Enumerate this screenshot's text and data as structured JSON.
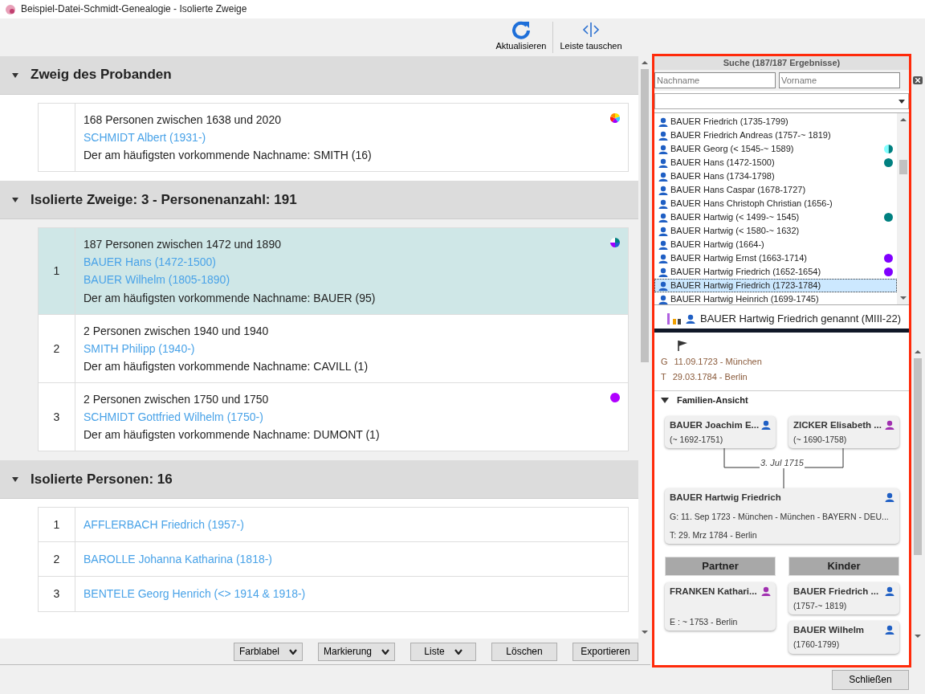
{
  "window": {
    "title": "Beispiel-Datei-Schmidt-Genealogie - Isolierte Zweige"
  },
  "toolbar": [
    {
      "label": "Aktualisieren",
      "kind": "refresh"
    },
    {
      "label": "Leiste tauschen",
      "kind": "swap"
    }
  ],
  "sections": [
    {
      "title": "Zweig des Probanden",
      "expanded": true,
      "items": [
        {
          "summary": "168 Personen zwischen 1638 und 2020",
          "persons": [
            "SCHMIDT Albert (1931-)"
          ],
          "note": "Der am häufigsten vorkommende Nachname: SMITH (16)",
          "selected": false,
          "segments": [
            {
              "color": "#ffe600"
            },
            {
              "color": "#33ccff"
            },
            {
              "color": "#a000ff"
            },
            {
              "color": "#ff1a1a"
            },
            {
              "color": "#ff8c00"
            }
          ]
        }
      ]
    },
    {
      "title": "Isolierte Zweige: 3 - Personenanzahl: 191",
      "expanded": true,
      "items": [
        {
          "number": "1",
          "summary": "187 Personen zwischen 1472 und 1890",
          "persons": [
            "BAUER Hans (1472-1500)",
            "BAUER Wilhelm (1805-1890)"
          ],
          "note": "Der am häufigsten vorkommende Nachname: BAUER (95)",
          "selected": true,
          "segments": [
            {
              "color": "#008080"
            },
            {
              "color": "#2060d0"
            },
            {
              "color": "#a000ff"
            },
            {
              "color": "#ffffff"
            }
          ]
        },
        {
          "number": "2",
          "summary": "2 Personen zwischen 1940 und 1940",
          "persons": [
            "SMITH Philipp (1940-)"
          ],
          "note": "Der am häufigsten vorkommende Nachname: CAVILL (1)",
          "selected": false
        },
        {
          "number": "3",
          "summary": "2 Personen zwischen 1750 und 1750",
          "persons": [
            "SCHMIDT Gottfried Wilhelm (1750-)"
          ],
          "note": "Der am häufigsten vorkommende Nachname: DUMONT (1)",
          "selected": false,
          "segments": [
            {
              "color": "#b000ff"
            }
          ]
        }
      ]
    },
    {
      "title": "Isolierte Personen: 16",
      "expanded": true,
      "items": [
        {
          "number": "1",
          "persons": [
            "AFFLERBACH Friedrich (1957-)"
          ],
          "selected": false
        },
        {
          "number": "2",
          "persons": [
            "BAROLLE Johanna Katharina (1818-)"
          ],
          "selected": false
        },
        {
          "number": "3",
          "persons": [
            "BENTELE Georg Henrich (<> 1914 & 1918-)"
          ],
          "selected": false
        }
      ]
    }
  ],
  "actions": [
    {
      "label": "Farblabel",
      "dropdown": true
    },
    {
      "label": "Markierung",
      "dropdown": true
    },
    {
      "label": "Liste",
      "dropdown": true
    },
    {
      "label": "Löschen",
      "dropdown": false
    },
    {
      "label": "Exportieren",
      "dropdown": false
    }
  ],
  "close_button": "Schließen",
  "side_panel": {
    "highlighted": true,
    "search": {
      "title": "Suche (187/187 Ergebnisse)",
      "surname_placeholder": "Nachname",
      "firstname_placeholder": "Vorname"
    },
    "results": [
      {
        "name": "BAUER Friedrich (1735-1799)",
        "selected": false
      },
      {
        "name": "BAUER Friedrich Andreas (1757-~ 1819)",
        "selected": false
      },
      {
        "name": "BAUER Georg (< 1545-~ 1589)",
        "selected": false,
        "segments": [
          {
            "color": "#008080"
          },
          {
            "color": "#80ffff"
          }
        ]
      },
      {
        "name": "BAUER Hans (1472-1500)",
        "selected": false,
        "segments": [
          {
            "color": "#008080"
          }
        ]
      },
      {
        "name": "BAUER Hans (1734-1798)",
        "selected": false
      },
      {
        "name": "BAUER Hans Caspar (1678-1727)",
        "selected": false
      },
      {
        "name": "BAUER Hans Christoph Christian (1656-)",
        "selected": false
      },
      {
        "name": "BAUER Hartwig (< 1499-~ 1545)",
        "selected": false,
        "segments": [
          {
            "color": "#008080"
          }
        ]
      },
      {
        "name": "BAUER Hartwig (< 1580-~ 1632)",
        "selected": false
      },
      {
        "name": "BAUER Hartwig (1664-)",
        "selected": false
      },
      {
        "name": "BAUER Hartwig Ernst (1663-1714)",
        "selected": false,
        "segments": [
          {
            "color": "#8000ff"
          }
        ]
      },
      {
        "name": "BAUER Hartwig Friedrich (1652-1654)",
        "selected": false,
        "segments": [
          {
            "color": "#8000ff"
          }
        ]
      },
      {
        "name": "BAUER Hartwig Friedrich (1723-1784)",
        "selected": true
      },
      {
        "name": "BAUER Hartwig Heinrich (1699-1745)",
        "selected": false
      }
    ],
    "person": {
      "name": "BAUER Hartwig Friedrich genannt (MIII-22)",
      "kind": "male",
      "events": [
        {
          "code": "G",
          "text": "11.09.1723 - München"
        },
        {
          "code": "T",
          "text": "29.03.1784 - Berlin"
        }
      ]
    },
    "family": {
      "title": "Familien-Ansicht",
      "expanded": true,
      "parents": [
        {
          "name": "BAUER Joachim E...",
          "dates": "(~ 1692-1751)",
          "kind": "male"
        },
        {
          "name": "ZICKER Elisabeth ...",
          "dates": "(~ 1690-1758)",
          "kind": "female"
        }
      ],
      "marriage": "3. Jul 1715",
      "main": {
        "name": "BAUER Hartwig Friedrich",
        "kind": "male",
        "lines": [
          "G: 11. Sep 1723 - München - München - BAYERN - DEU...",
          "T: 29. Mrz 1784 - Berlin"
        ]
      },
      "partner_title": "Partner",
      "children_title": "Kinder",
      "partners": [
        {
          "name": "FRANKEN Kathari...",
          "kind": "female",
          "lines": [
            "E : ~ 1753 - Berlin"
          ]
        }
      ],
      "children": [
        {
          "name": "BAUER Friedrich ...",
          "dates": "(1757-~ 1819)",
          "kind": "male"
        },
        {
          "name": "BAUER Wilhelm",
          "dates": "(1760-1799)",
          "kind": "male"
        }
      ]
    }
  }
}
